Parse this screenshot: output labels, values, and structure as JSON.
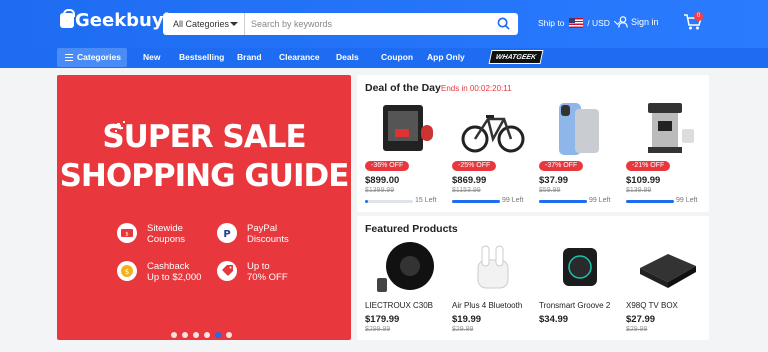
{
  "header": {
    "logo": "Geekbuying",
    "search": {
      "category": "All Categories",
      "placeholder": "Search by keywords"
    },
    "ship_to": "Ship to",
    "currency": "/ USD",
    "sign_in": "Sign in",
    "cart_count": "0"
  },
  "nav": {
    "categories": "Categories",
    "links": [
      "New",
      "Bestselling",
      "Brand",
      "Clearance",
      "Deals",
      "Coupon",
      "App Only"
    ],
    "whatgeek": "WHATGEEK"
  },
  "banner": {
    "title_line1": "SUPER SALE",
    "title_line2": "SHOPPING GUIDE",
    "features": [
      {
        "icon": "coupon-icon",
        "line1": "Sitewide",
        "line2": "Coupons"
      },
      {
        "icon": "paypal-icon",
        "line1": "PayPal",
        "line2": "Discounts"
      },
      {
        "icon": "cashback-icon",
        "line1": "Cashback",
        "line2": "Up to $2,000"
      },
      {
        "icon": "discount-tag-icon",
        "line1": "Up to",
        "line2": "70% OFF"
      }
    ],
    "slide_count": 6,
    "active_slide": 5
  },
  "deal_of_the_day": {
    "title": "Deal of the Day",
    "ends_in": "Ends in 00:02:20:11",
    "items": [
      {
        "icon": "3d-printer-icon",
        "off": "-36% OFF",
        "price": "$899.00",
        "old": "$1399.99",
        "left": "15 Left",
        "progress": 0.06
      },
      {
        "icon": "e-bike-icon",
        "off": "-25% OFF",
        "price": "$869.99",
        "old": "$1153.99",
        "left": "99 Left",
        "progress": 1.0
      },
      {
        "icon": "power-bank-icon",
        "off": "-37% OFF",
        "price": "$37.99",
        "old": "$59.99",
        "left": "99 Left",
        "progress": 1.0
      },
      {
        "icon": "coffee-machine-icon",
        "off": "-21% OFF",
        "price": "$109.99",
        "old": "$139.99",
        "left": "99 Left",
        "progress": 1.0
      }
    ]
  },
  "featured": {
    "title": "Featured Products",
    "items": [
      {
        "icon": "robot-vacuum-icon",
        "name": "LIECTROUX C30B",
        "price": "$179.99",
        "old": "$299.99"
      },
      {
        "icon": "earbuds-icon",
        "name": "Air Plus 4 Bluetooth",
        "price": "$19.99",
        "old": "$29.99"
      },
      {
        "icon": "speaker-icon",
        "name": "Tronsmart Groove 2",
        "price": "$34.99",
        "old": ""
      },
      {
        "icon": "tv-box-icon",
        "name": "X98Q TV BOX",
        "price": "$27.99",
        "old": "$29.99"
      }
    ]
  },
  "colors": {
    "brand_blue": "#1d6cf2",
    "banner_red": "#e8383d"
  }
}
